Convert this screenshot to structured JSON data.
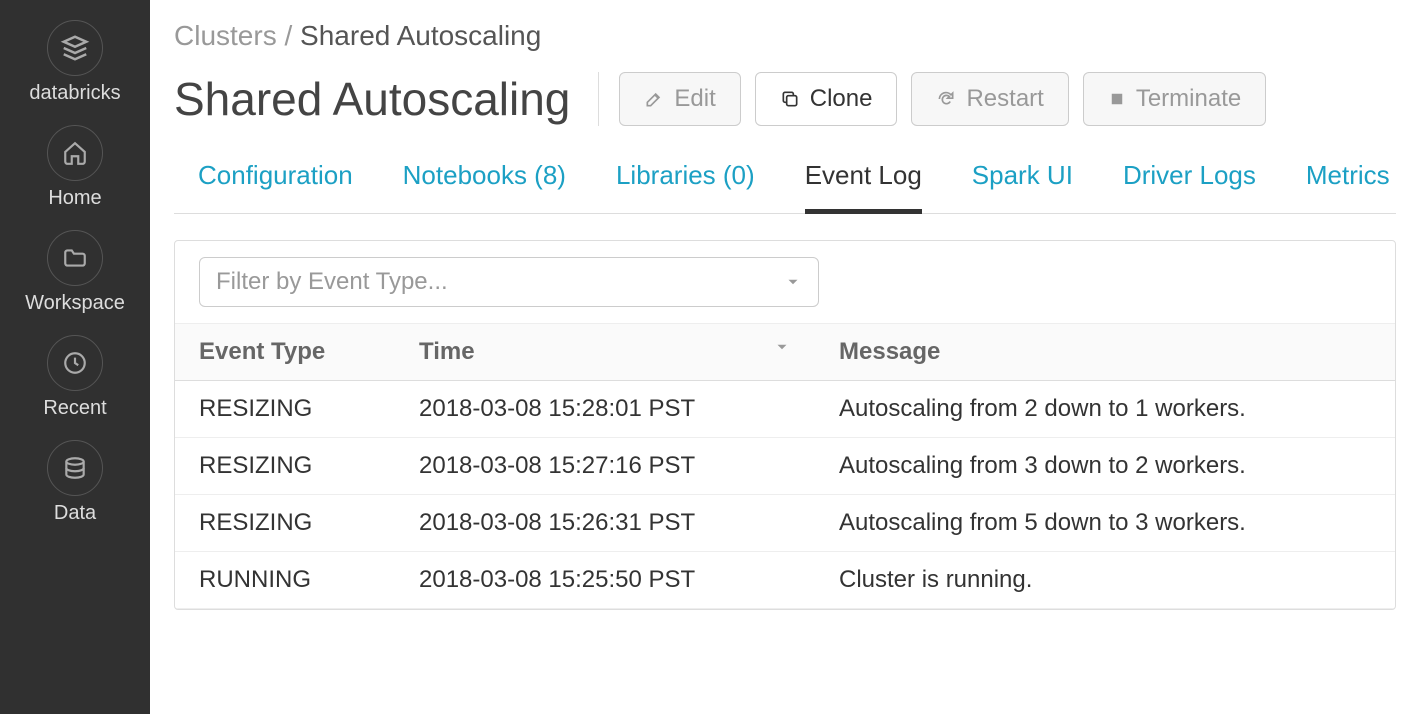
{
  "brand": "databricks",
  "sidebar": {
    "items": [
      {
        "label": "Home"
      },
      {
        "label": "Workspace"
      },
      {
        "label": "Recent"
      },
      {
        "label": "Data"
      }
    ]
  },
  "breadcrumb": {
    "parent": "Clusters",
    "sep": "/",
    "current": "Shared Autoscaling"
  },
  "page": {
    "title": "Shared Autoscaling"
  },
  "actions": {
    "edit": "Edit",
    "clone": "Clone",
    "restart": "Restart",
    "terminate": "Terminate"
  },
  "tabs": {
    "configuration": "Configuration",
    "notebooks": "Notebooks (8)",
    "libraries": "Libraries (0)",
    "eventlog": "Event Log",
    "sparkui": "Spark UI",
    "driverlogs": "Driver Logs",
    "metrics": "Metrics"
  },
  "filter": {
    "placeholder": "Filter by Event Type..."
  },
  "table": {
    "headers": {
      "type": "Event Type",
      "time": "Time",
      "message": "Message"
    },
    "rows": [
      {
        "type": "RESIZING",
        "time": "2018-03-08 15:28:01 PST",
        "message": "Autoscaling from 2 down to 1 workers."
      },
      {
        "type": "RESIZING",
        "time": "2018-03-08 15:27:16 PST",
        "message": "Autoscaling from 3 down to 2 workers."
      },
      {
        "type": "RESIZING",
        "time": "2018-03-08 15:26:31 PST",
        "message": "Autoscaling from 5 down to 3 workers."
      },
      {
        "type": "RUNNING",
        "time": "2018-03-08 15:25:50 PST",
        "message": "Cluster is running."
      }
    ]
  }
}
